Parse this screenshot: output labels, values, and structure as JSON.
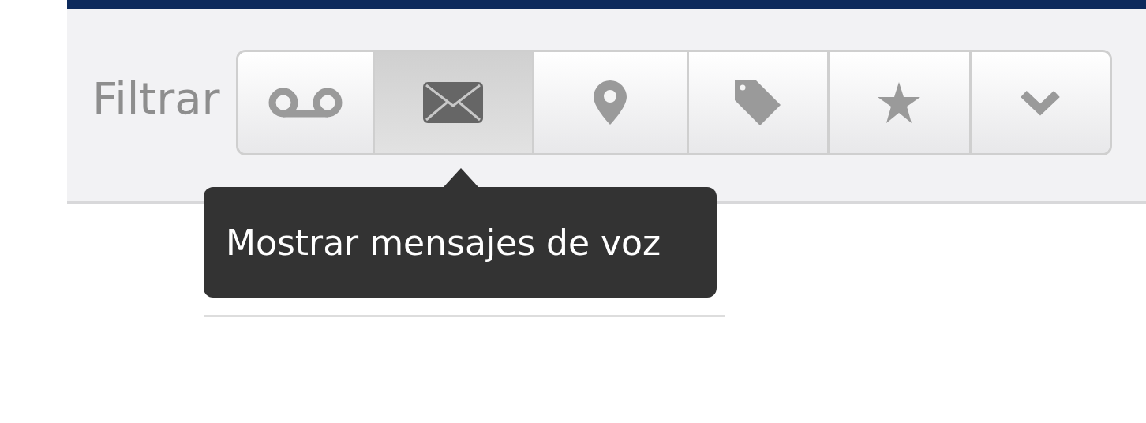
{
  "filter_bar": {
    "label": "Filtrar",
    "buttons": [
      {
        "selected": false
      },
      {
        "selected": true
      },
      {
        "selected": false
      },
      {
        "selected": false
      },
      {
        "selected": false
      },
      {
        "selected": false
      }
    ]
  },
  "tooltip": {
    "text": "Mostrar mensajes de voz"
  }
}
